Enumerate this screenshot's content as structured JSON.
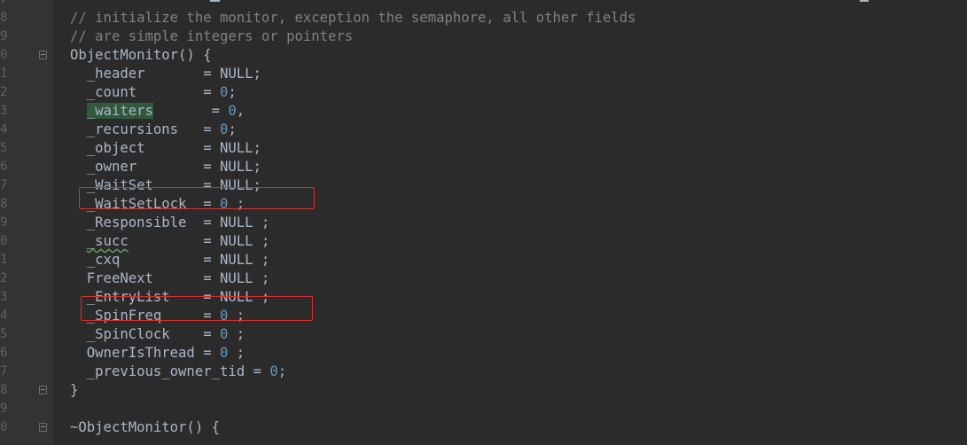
{
  "editor": {
    "theme": {
      "background": "#2b2b2b",
      "gutter": "#313335",
      "text": "#a9b7c6",
      "comment": "#808080",
      "number": "#6897bb",
      "line_number": "#606366",
      "highlight": "#32593d",
      "annotation_box": "#d6302c"
    },
    "lines": [
      {
        "num": "7",
        "fold": false,
        "tokens": [
          {
            "t": "",
            "c": "plain"
          }
        ]
      },
      {
        "num": "8",
        "fold": false,
        "tokens": [
          {
            "t": "// initialize the monitor, exception the semaphore, all other fields",
            "c": "comment"
          }
        ]
      },
      {
        "num": "9",
        "fold": false,
        "tokens": [
          {
            "t": "// are simple integers or pointers",
            "c": "comment"
          }
        ]
      },
      {
        "num": "0",
        "fold": true,
        "tokens": [
          {
            "t": "ObjectMonitor() {",
            "c": "plain"
          }
        ]
      },
      {
        "num": "1",
        "fold": false,
        "tokens": [
          {
            "t": "  _header       = NULL;",
            "c": "plain"
          }
        ]
      },
      {
        "num": "2",
        "fold": false,
        "tokens": [
          {
            "t": "  _count        = ",
            "c": "plain"
          },
          {
            "t": "0",
            "c": "num"
          },
          {
            "t": ";",
            "c": "plain"
          }
        ]
      },
      {
        "num": "3",
        "fold": false,
        "tokens": [
          {
            "t": "  ",
            "c": "plain"
          },
          {
            "t": "_waiters",
            "c": "hl"
          },
          {
            "t": "       = ",
            "c": "plain"
          },
          {
            "t": "0",
            "c": "num"
          },
          {
            "t": ",",
            "c": "plain"
          }
        ]
      },
      {
        "num": "4",
        "fold": false,
        "tokens": [
          {
            "t": "  _recursions   = ",
            "c": "plain"
          },
          {
            "t": "0",
            "c": "num"
          },
          {
            "t": ";",
            "c": "plain"
          }
        ]
      },
      {
        "num": "5",
        "fold": false,
        "tokens": [
          {
            "t": "  _object       = NULL;",
            "c": "plain"
          }
        ]
      },
      {
        "num": "6",
        "fold": false,
        "tokens": [
          {
            "t": "  _owner        = NULL;",
            "c": "plain"
          }
        ]
      },
      {
        "num": "7",
        "fold": false,
        "tokens": [
          {
            "t": "  _WaitSet      = NULL;",
            "c": "plain"
          }
        ]
      },
      {
        "num": "8",
        "fold": false,
        "tokens": [
          {
            "t": "  _WaitSetLock  = ",
            "c": "plain"
          },
          {
            "t": "0",
            "c": "num"
          },
          {
            "t": " ;",
            "c": "plain"
          }
        ]
      },
      {
        "num": "9",
        "fold": false,
        "tokens": [
          {
            "t": "  _Responsible  = NULL ;",
            "c": "plain"
          }
        ]
      },
      {
        "num": "0",
        "fold": false,
        "tokens": [
          {
            "t": "  ",
            "c": "plain"
          },
          {
            "t": "_succ",
            "c": "wavy"
          },
          {
            "t": "         = NULL ;",
            "c": "plain"
          }
        ]
      },
      {
        "num": "1",
        "fold": false,
        "tokens": [
          {
            "t": "  _cxq          = NULL ;",
            "c": "plain"
          }
        ]
      },
      {
        "num": "2",
        "fold": false,
        "tokens": [
          {
            "t": "  FreeNext      = NULL ;",
            "c": "plain"
          }
        ]
      },
      {
        "num": "3",
        "fold": false,
        "tokens": [
          {
            "t": "  _EntryList    = NULL ;",
            "c": "plain"
          }
        ]
      },
      {
        "num": "4",
        "fold": false,
        "tokens": [
          {
            "t": "  _SpinFreq     = ",
            "c": "plain"
          },
          {
            "t": "0",
            "c": "num"
          },
          {
            "t": " ;",
            "c": "plain"
          }
        ]
      },
      {
        "num": "5",
        "fold": false,
        "tokens": [
          {
            "t": "  _SpinClock    = ",
            "c": "plain"
          },
          {
            "t": "0",
            "c": "num"
          },
          {
            "t": " ;",
            "c": "plain"
          }
        ]
      },
      {
        "num": "6",
        "fold": false,
        "tokens": [
          {
            "t": "  OwnerIsThread = ",
            "c": "plain"
          },
          {
            "t": "0",
            "c": "num"
          },
          {
            "t": " ;",
            "c": "plain"
          }
        ]
      },
      {
        "num": "7",
        "fold": false,
        "tokens": [
          {
            "t": "  _previous_owner_tid = ",
            "c": "plain"
          },
          {
            "t": "0",
            "c": "num"
          },
          {
            "t": ";",
            "c": "plain"
          }
        ]
      },
      {
        "num": "8",
        "fold": true,
        "tokens": [
          {
            "t": "}",
            "c": "plain"
          }
        ]
      },
      {
        "num": "9",
        "fold": false,
        "tokens": [
          {
            "t": "",
            "c": "plain"
          }
        ]
      },
      {
        "num": "0",
        "fold": true,
        "tokens": [
          {
            "t": "~ObjectMonitor() {",
            "c": "plain"
          }
        ]
      }
    ]
  }
}
